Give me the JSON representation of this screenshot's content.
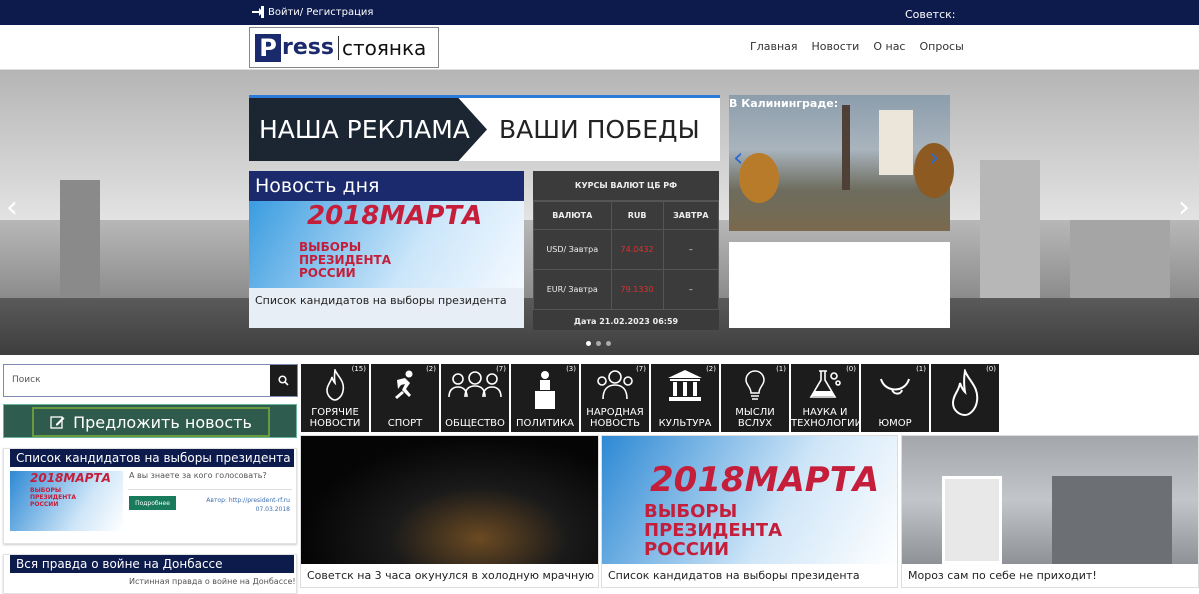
{
  "topbar": {
    "login": "Войти/ Регистрация",
    "city": "Советск:"
  },
  "logo": {
    "p": "P",
    "ress": "ress",
    "st": "стоянка"
  },
  "nav": [
    "Главная",
    "Новости",
    "О нас",
    "Опросы"
  ],
  "ad": {
    "left": "НАША РЕКЛАМА",
    "right": "ВАШИ ПОБЕДЫ"
  },
  "news_of_day": {
    "title": "Новость дня",
    "image_date": "2018МАРТА",
    "image_text": [
      "ВЫБОРЫ",
      "ПРЕЗИДЕНТА",
      "РОССИИ"
    ],
    "caption": "Список кандидатов на выборы президента"
  },
  "currency": {
    "title": "КУРСЫ ВАЛЮТ ЦБ РФ",
    "headers": [
      "ВАЛЮТА",
      "RUB",
      "ЗАВТРА"
    ],
    "rows": [
      {
        "name": "USD/ Завтра",
        "rate": "74.0432",
        "tomorrow": "–"
      },
      {
        "name": "EUR/ Завтра",
        "rate": "79.1330",
        "tomorrow": "–"
      }
    ],
    "date": "Дата 21.02.2023 06:59"
  },
  "kaliningrad": {
    "title": "В Калининграде:"
  },
  "search": {
    "placeholder": "Поиск"
  },
  "suggest": {
    "label": "Предложить новость"
  },
  "cards": [
    {
      "title": "Список кандидатов на выборы президента",
      "question": "А вы знаете за кого голосовать?",
      "more": "Подробнее",
      "author": "Автор: http://president-rf.ru",
      "date": "07.03.2018"
    },
    {
      "title": "Вся правда о войне на Донбассе",
      "question": "Истинная правда о войне на Донбассе!"
    }
  ],
  "categories": [
    {
      "label": "ГОРЯЧИЕ НОВОСТИ",
      "count": "(15)",
      "icon": "fire-icon"
    },
    {
      "label": "СПОРТ",
      "count": "(2)",
      "icon": "runner-icon"
    },
    {
      "label": "ОБЩЕСТВО",
      "count": "(7)",
      "icon": "people-icon"
    },
    {
      "label": "ПОЛИТИКА",
      "count": "(3)",
      "icon": "speaker-icon"
    },
    {
      "label": "НАРОДНАЯ НОВОСТЬ",
      "count": "(7)",
      "icon": "crowd-icon"
    },
    {
      "label": "КУЛЬТУРА",
      "count": "(2)",
      "icon": "museum-icon"
    },
    {
      "label": "МЫСЛИ ВСЛУХ",
      "count": "(1)",
      "icon": "bulb-icon"
    },
    {
      "label": "НАУКА И ТЕХНОЛОГИИ",
      "count": "(0)",
      "icon": "flask-icon"
    },
    {
      "label": "ЮМОР",
      "count": "(1)",
      "icon": "smile-icon"
    },
    {
      "label": "",
      "count": "(0)",
      "icon": "flame-icon"
    }
  ],
  "tiles": [
    {
      "caption": "Советск на 3 часа окунулся в холодную мрачную ночь"
    },
    {
      "caption": "Список кандидатов на выборы президента"
    },
    {
      "caption": "Мороз сам по себе не приходит!"
    }
  ]
}
